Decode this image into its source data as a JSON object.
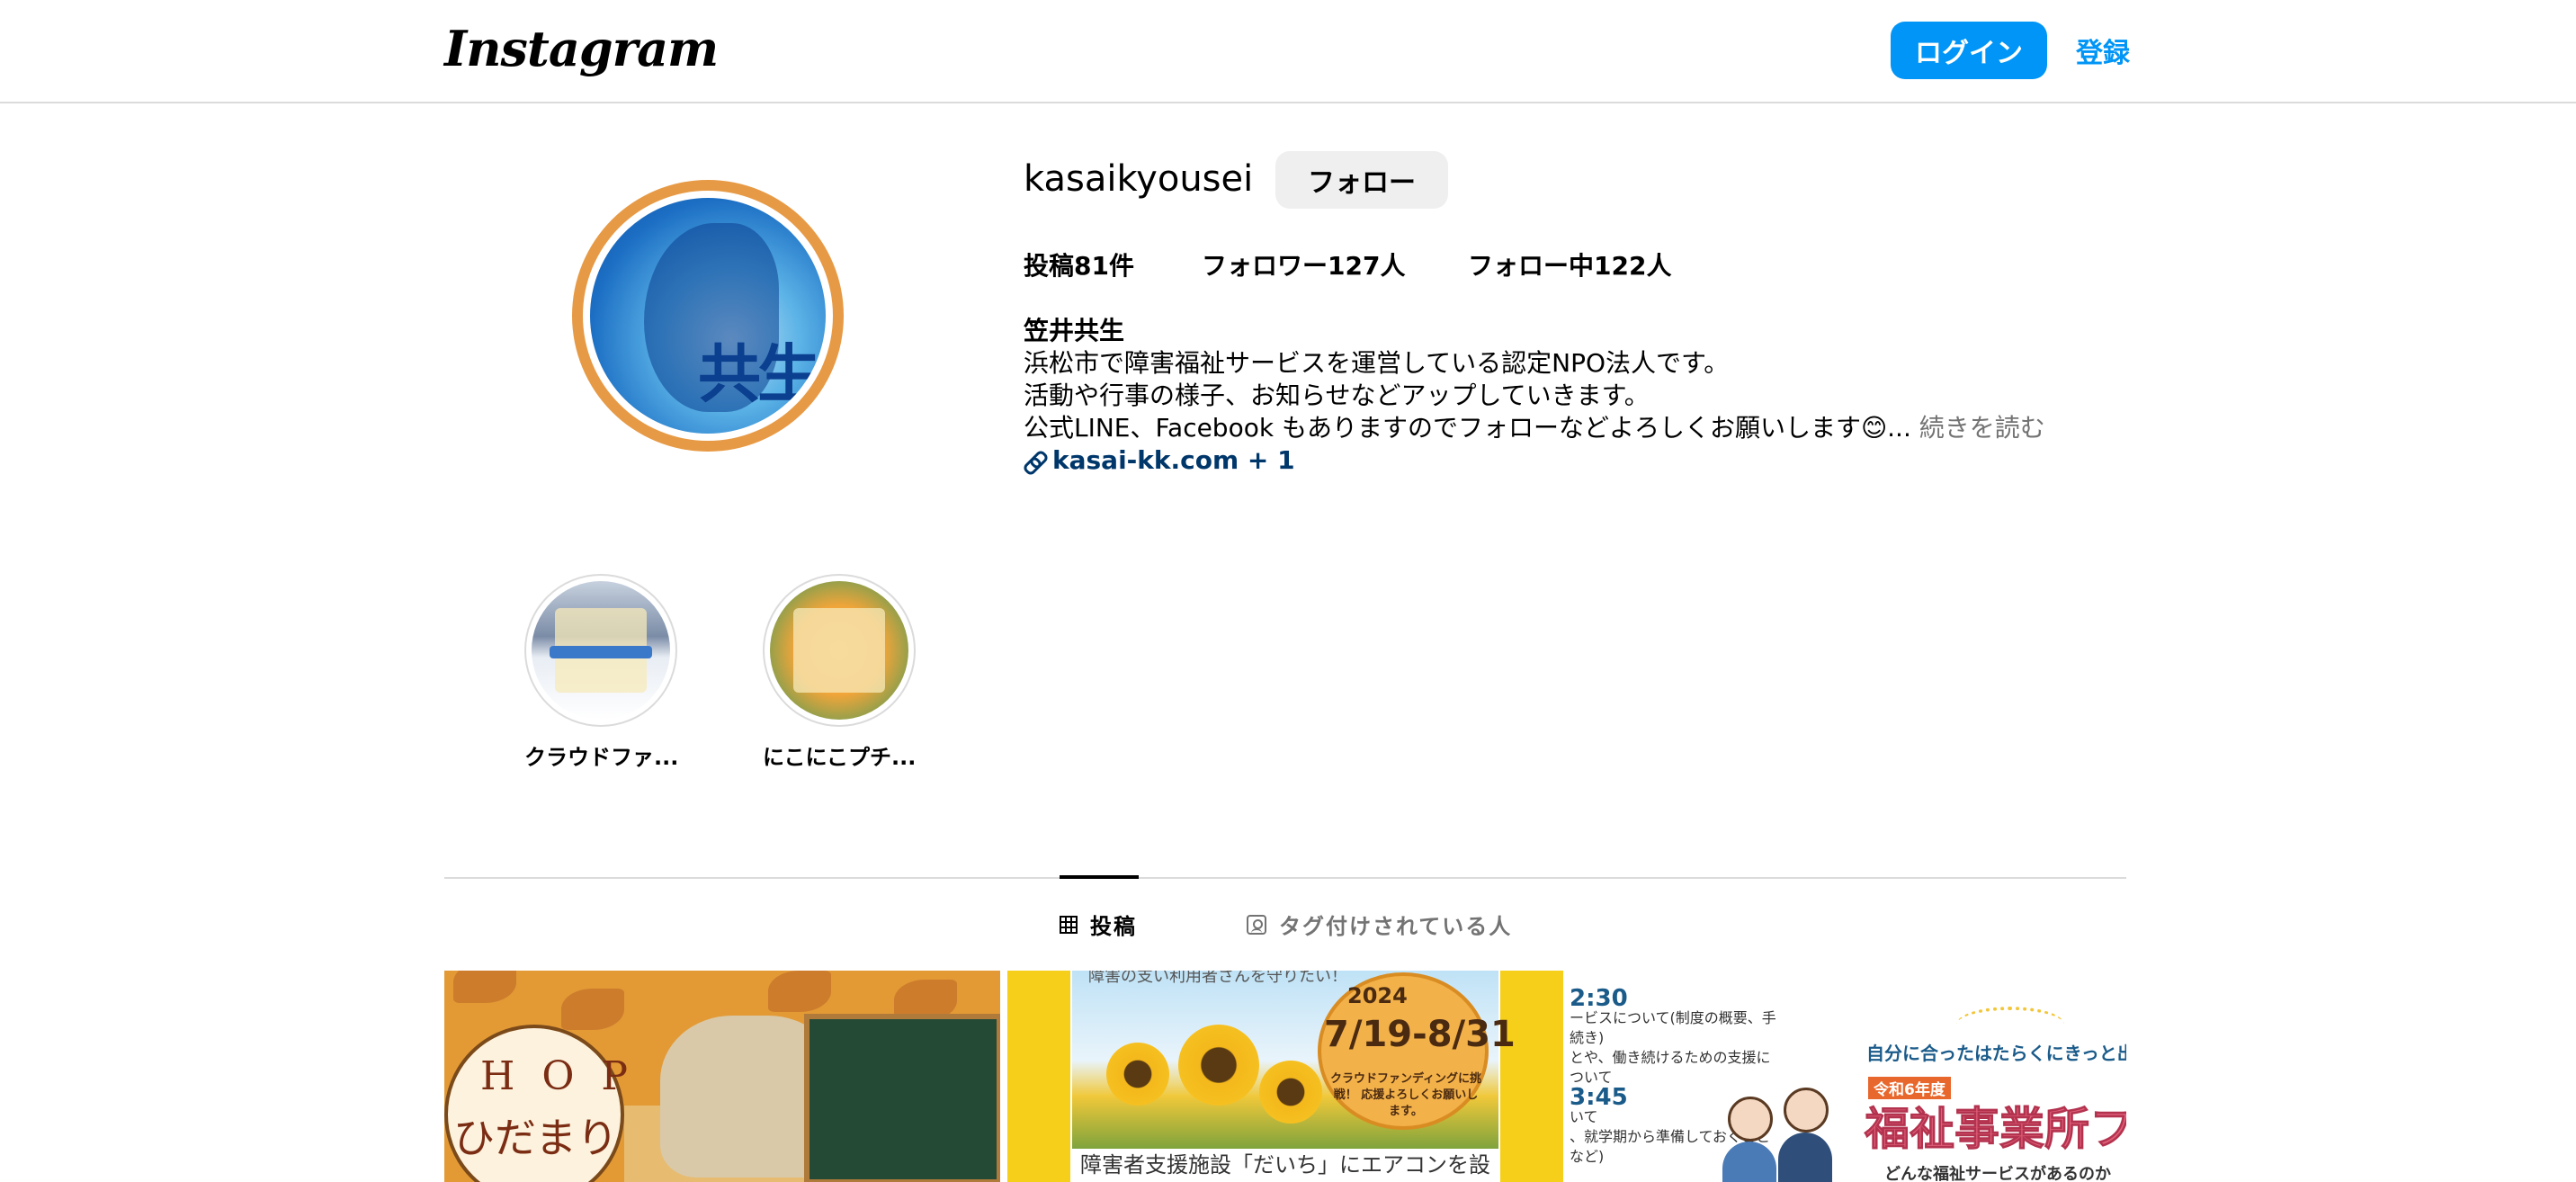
{
  "header": {
    "logo": "Instagram",
    "login_label": "ログイン",
    "signup_label": "登録"
  },
  "profile": {
    "username": "kasaikyousei",
    "follow_label": "フォロー",
    "avatar_text": "共生",
    "stats": {
      "posts": "投稿81件",
      "followers": "フォロワー127人",
      "following": "フォロー中122人"
    },
    "bio": {
      "name": "笠井共生",
      "line1": "浜松市で障害福祉サービスを運営している認定NPO法人です。",
      "line2": "活動や行事の様子、お知らせなどアップしていきます。",
      "line3": "公式LINE、Facebook もありますのでフォローなどよろしくお願いします😊...",
      "more": " 続きを読む",
      "link": "kasai-kk.com + 1"
    }
  },
  "highlights": [
    {
      "label": "クラウドファ..."
    },
    {
      "label": "にこにこプチ..."
    }
  ],
  "tabs": {
    "posts": "投稿",
    "tagged": "タグ付けされている人"
  },
  "posts": [
    {
      "text_shop": "H O P",
      "text_hida": "ひだまり"
    },
    {
      "top_caption": "障害の支い利用者さんを守りたい！",
      "year": "2024",
      "dates": "7/19-8/31",
      "note": "クラウドファンディングに挑戦！ 応援よろしくお願いします。",
      "caption": "障害者支援施設「だいち」にエアコンを設置したい"
    },
    {
      "time1": "2:30",
      "line1": "ービスについて(制度の概要、手続き)",
      "line2": "とや、働き続けるための支援について",
      "time2": "3:45",
      "line3": "いて",
      "line4": "、就学期から準備しておくことなど)",
      "headline": "自分に合ったはたらくにきっと出会",
      "tag": "令和6年度",
      "fair": "福祉事業所フェ",
      "sub": "どんな福祉サービスがあるのか"
    }
  ],
  "colors": {
    "primary_blue": "#0095f6",
    "link_dark": "#00376b",
    "muted": "#737373",
    "border": "#dbdbdb"
  }
}
